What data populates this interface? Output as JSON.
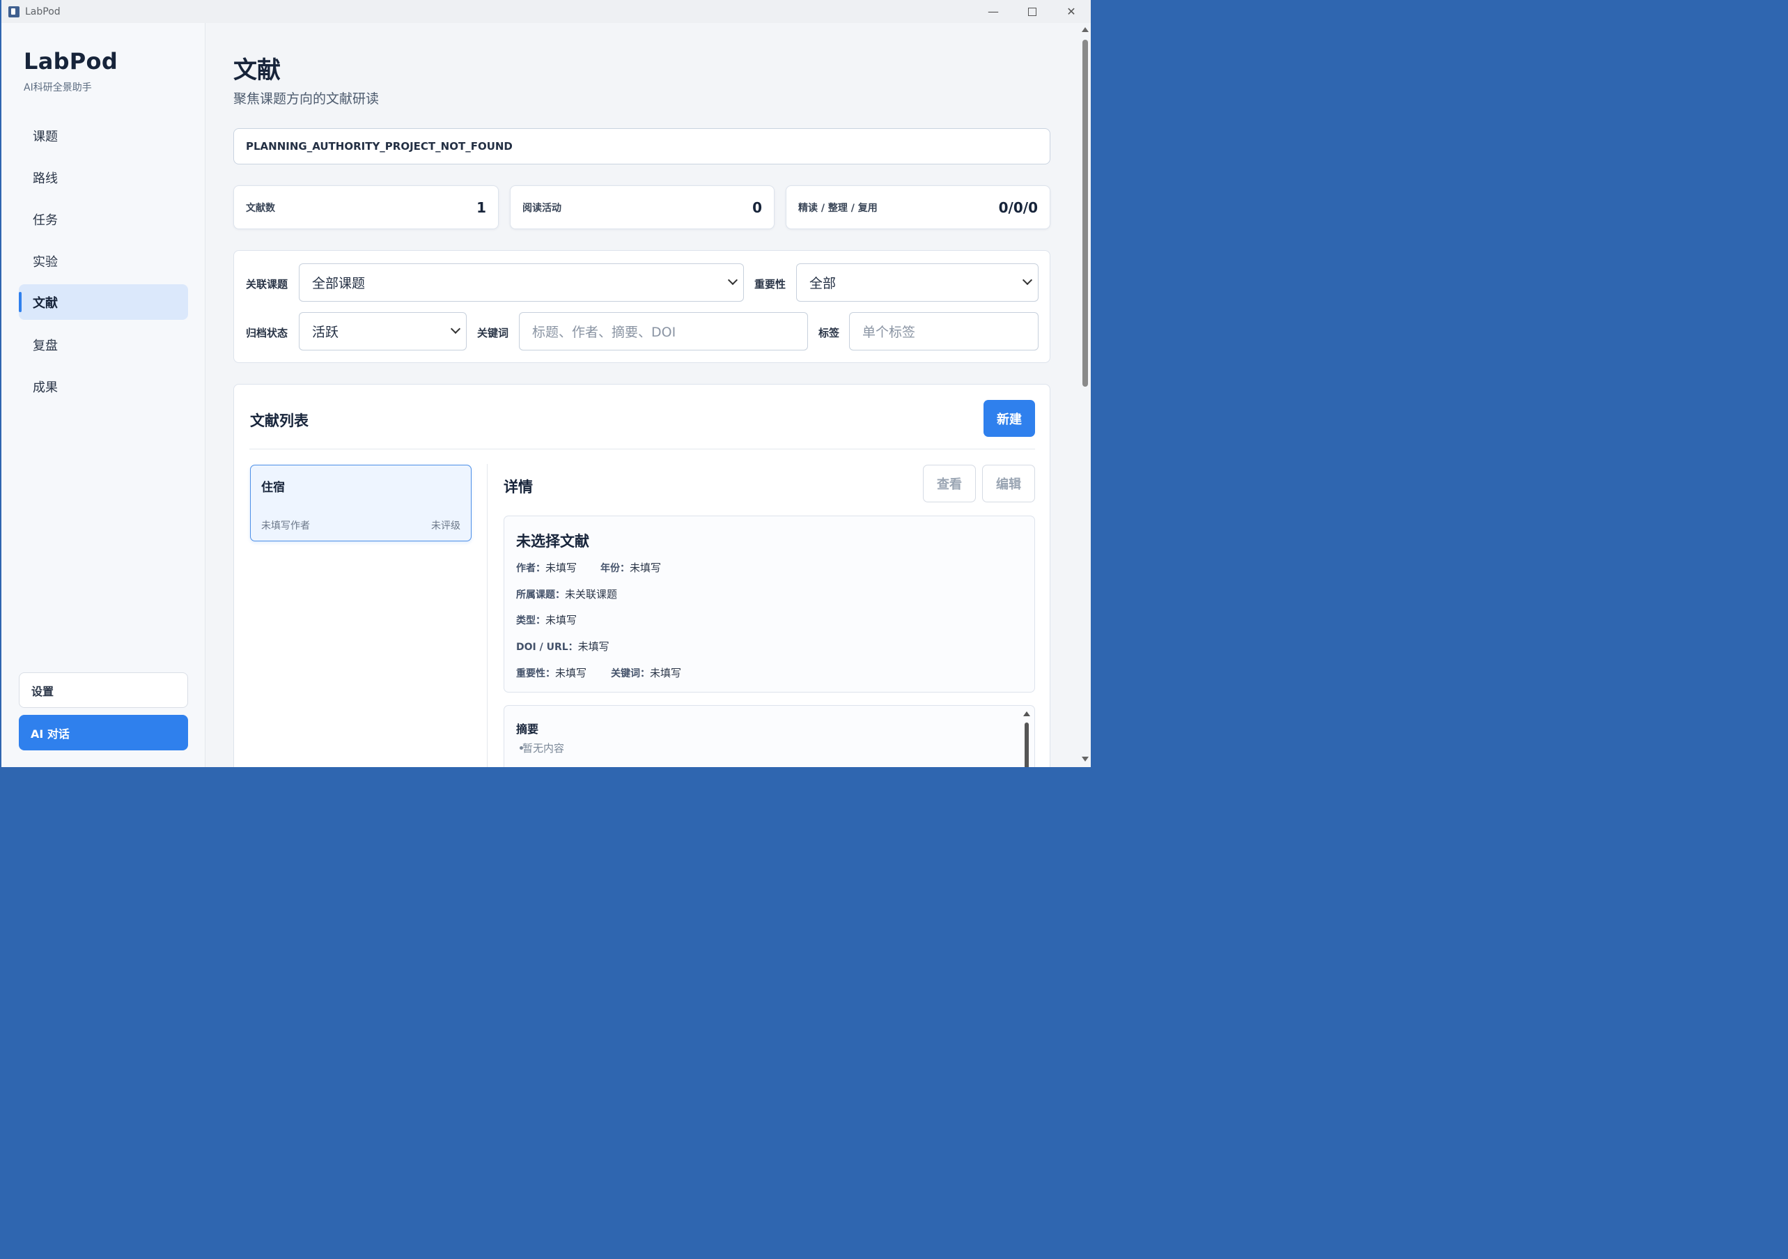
{
  "window": {
    "title": "LabPod"
  },
  "brand": {
    "name": "LabPod",
    "tagline": "AI科研全景助手"
  },
  "nav": {
    "items": [
      {
        "label": "课题"
      },
      {
        "label": "路线"
      },
      {
        "label": "任务"
      },
      {
        "label": "实验"
      },
      {
        "label": "文献",
        "active": true
      },
      {
        "label": "复盘"
      },
      {
        "label": "成果"
      }
    ],
    "settings_label": "设置",
    "ai_chat_label": "AI 对话"
  },
  "page": {
    "title": "文献",
    "subtitle": "聚焦课题方向的文献研读",
    "banner": "PLANNING_AUTHORITY_PROJECT_NOT_FOUND"
  },
  "stats": [
    {
      "label": "文献数",
      "value": "1"
    },
    {
      "label": "阅读活动",
      "value": "0"
    },
    {
      "label": "精读 / 整理 / 复用",
      "value": "0/0/0"
    }
  ],
  "filters": {
    "project": {
      "label": "关联课题",
      "value": "全部课题"
    },
    "importance": {
      "label": "重要性",
      "value": "全部"
    },
    "archive": {
      "label": "归档状态",
      "value": "活跃"
    },
    "keyword": {
      "label": "关键词",
      "placeholder": "标题、作者、摘要、DOI"
    },
    "tag": {
      "label": "标签",
      "placeholder": "单个标签"
    }
  },
  "list": {
    "title": "文献列表",
    "new_label": "新建",
    "items": [
      {
        "title": "住宿",
        "author": "未填写作者",
        "rating": "未评级"
      }
    ]
  },
  "detail": {
    "title": "详情",
    "view_label": "查看",
    "edit_label": "编辑",
    "heading": "未选择文献",
    "author_key": "作者：",
    "author_val": "未填写",
    "year_key": "年份：",
    "year_val": "未填写",
    "project_key": "所属课题：",
    "project_val": "未关联课题",
    "type_key": "类型：",
    "type_val": "未填写",
    "doi_key": "DOI / URL：",
    "doi_val": "未填写",
    "importance_key": "重要性：",
    "importance_val": "未填写",
    "keywords_key": "关键词：",
    "keywords_val": "未填写",
    "abstract_title": "摘要",
    "abstract_item": "暂无内容"
  },
  "colors": {
    "accent": "#2f80ed",
    "active_nav_bg": "#dbe8fb",
    "page_bg": "#f3f5f8"
  },
  "icons": {
    "minimize": "minimize-icon",
    "maximize": "maximize-icon",
    "close": "close-icon",
    "dropdown": "chevron-down-icon"
  }
}
